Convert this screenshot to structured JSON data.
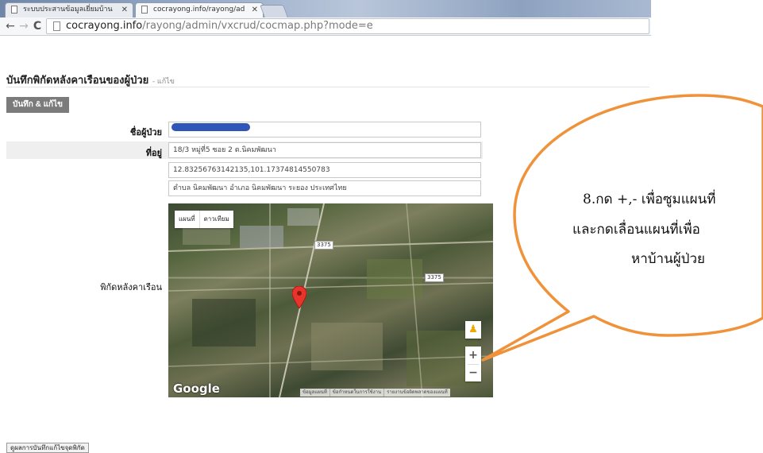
{
  "browser": {
    "tabs": [
      {
        "label": "ระบบประสานข้อมูลเยี่ยมบ้าน",
        "active": false
      },
      {
        "label": "cocrayong.info/rayong/ad",
        "active": true
      }
    ],
    "url_host": "cocrayong.info",
    "url_path": "/rayong/admin/vxcrud/cocmap.php?mode=e"
  },
  "page": {
    "title": "บันทึกพิกัดหลังคาเรือนของผู้ป่วย",
    "subtitle": "- แก้ไข",
    "save_button": "บันทึก & แก้ไข",
    "bottom_button": "ดูผลการบันทึกแก้ไขจุดพิกัด"
  },
  "form": {
    "patient_name_label": "ชื่อผู้ป่วย",
    "address_label": "ที่อยู่",
    "address_value": "18/3 หมู่ที่5 ซอย 2 ต.นิคมพัฒนา",
    "coords_value": "12.83256763142135,101.17374814550783",
    "location_value": "ตำบล นิคมพัฒนา อำเภอ นิคมพัฒนา ระยอง ประเทศไทย",
    "map_label": "พิกัดหลังคาเรือน"
  },
  "map": {
    "type_map": "แผนที่",
    "type_satellite": "ดาวเทียม",
    "road_labels": [
      "3375",
      "3375"
    ],
    "logo": "Google",
    "zoom_in": "+",
    "zoom_out": "−",
    "attribution": [
      "ข้อมูลแผนที่",
      "ข้อกำหนดในการใช้งาน",
      "รายงานข้อผิดพลาดของแผนที่"
    ]
  },
  "callout": {
    "lines": [
      "8.กด +,- เพื่อซูมแผนที่",
      "และกดเลื่อนแผนที่เพื่อ",
      "หาบ้านผู้ป่วย"
    ],
    "outline_color": "#f0923a"
  },
  "colors": {
    "redacted_bar": "#2f55b8",
    "save_button_bg": "#7b7b7b",
    "marker": "#e8342b"
  }
}
